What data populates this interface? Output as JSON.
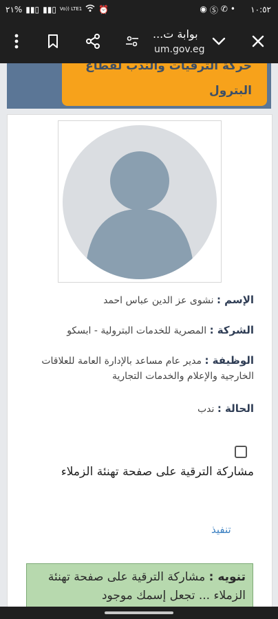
{
  "status_bar": {
    "time": "١٠:٥٢",
    "battery": "٢١%",
    "network": "Vo)) LTE1"
  },
  "browser": {
    "page_title": "بوابة ت...",
    "url": "um.gov.eg"
  },
  "banner": {
    "line1": "حركة الترقيات والندب لقطاع",
    "line2": "البترول"
  },
  "profile": {
    "name_label": "الإسم :",
    "name_value": "نشوى عز الدين عباس احمد",
    "company_label": "الشركة :",
    "company_value": "المصرية للخدمات البترولية - ابسكو",
    "job_label": "الوظيفة :",
    "job_value": "مدير عام مساعد بالإدارة العامة للعلاقات الخارجية والإعلام والخدمات التجارية",
    "status_label": "الحالة :",
    "status_value": "ندب"
  },
  "share": {
    "checkbox_label": "مشاركة الترقية على صفحة تهنئة الزملاء",
    "submit_label": "تنفيذ"
  },
  "notice": {
    "label": "تنويه :",
    "text": "مشاركة الترقية على صفحة تهنئة الزملاء ... تجعل إسمك موجود"
  },
  "colors": {
    "banner_orange": "#f7a21b",
    "banner_blue": "#5b7696",
    "link_blue": "#3a7fc1",
    "notice_green": "#b7d9ae",
    "avatar_gray": "#8a9fb0"
  }
}
